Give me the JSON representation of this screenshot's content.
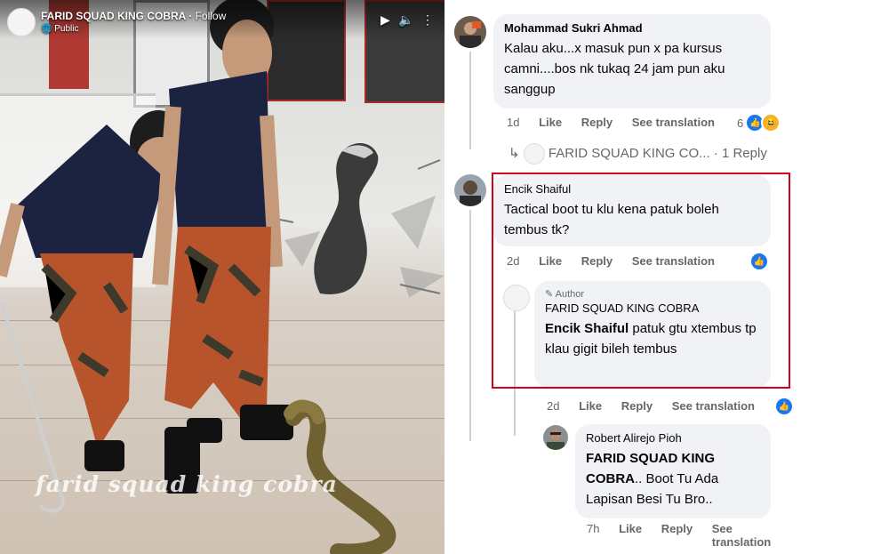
{
  "video": {
    "page_name": "FARID SQUAD KING COBRA",
    "follow": "Follow",
    "privacy": "Public",
    "watermark": "farid squad king cobra"
  },
  "comments": [
    {
      "name": "Mohammad Sukri Ahmad",
      "text": "Kalau aku...x masuk pun x pa kursus camni....bos nk tukaq 24 jam pun aku sanggup",
      "time": "1d",
      "like": "Like",
      "reply": "Reply",
      "see_translation": "See translation",
      "reaction_count": "6",
      "reply_summary_name": "FARID SQUAD KING CO...",
      "reply_summary_count": "1 Reply"
    },
    {
      "name": "Encik Shaiful",
      "text": "Tactical boot tu klu kena patuk boleh tembus tk?",
      "time": "2d",
      "like": "Like",
      "reply": "Reply",
      "see_translation": "See translation"
    },
    {
      "author_tag": "Author",
      "name": "FARID SQUAD KING COBRA",
      "mention": "Encik Shaiful",
      "text": "patuk gtu xtembus tp klau gigit bileh tembus",
      "time": "2d",
      "like": "Like",
      "reply": "Reply",
      "see_translation": "See translation"
    },
    {
      "name": "Robert Alirejo Pioh",
      "mention": "FARID SQUAD KING COBRA",
      "text": ".. Boot Tu Ada Lapisan Besi Tu Bro..",
      "time": "7h",
      "like": "Like",
      "reply": "Reply",
      "see_translation": "See translation"
    }
  ],
  "colors": {
    "facebook_blue": "#1877f2",
    "highlight_red": "#d0021b",
    "bubble_gray": "#f0f2f5"
  }
}
